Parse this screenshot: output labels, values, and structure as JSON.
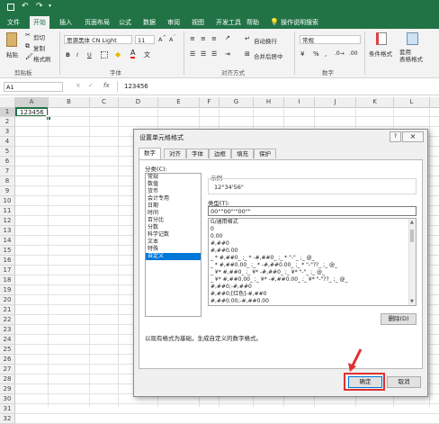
{
  "titlebar": {
    "save_icon": "save-icon",
    "undo_icon": "undo-icon",
    "redo_icon": "redo-icon"
  },
  "tabs": [
    "文件",
    "开始",
    "插入",
    "页面布局",
    "公式",
    "数据",
    "审阅",
    "视图",
    "开发工具",
    "帮助"
  ],
  "active_tab": "开始",
  "tell_me": "操作说明搜索",
  "ribbon": {
    "paste": "粘贴",
    "cut": "剪切",
    "copy": "复制",
    "format_painter": "格式刷",
    "clipboard": "剪贴板",
    "font_name": "思源黑体 CN Light",
    "font_size": "11",
    "font_group": "字体",
    "bold": "B",
    "italic": "I",
    "underline": "U",
    "wrap_text": "自动换行",
    "merge_center": "合并后居中",
    "align_group": "对齐方式",
    "number_format": "常规",
    "number_group": "数字",
    "conditional_format": "条件格式",
    "format_as_table": "套用\n表格格式"
  },
  "formula_bar": {
    "name_box": "A1",
    "fx": "fx",
    "value": "123456"
  },
  "columns": [
    "A",
    "B",
    "C",
    "D",
    "E",
    "F",
    "G",
    "H",
    "I",
    "J",
    "K",
    "L"
  ],
  "rows": [
    "1",
    "2",
    "3",
    "4",
    "5",
    "6",
    "7",
    "8",
    "9",
    "10",
    "11",
    "12",
    "13",
    "14",
    "15",
    "16",
    "17",
    "18",
    "19",
    "20",
    "21",
    "22",
    "23",
    "24",
    "25",
    "26",
    "27",
    "28",
    "29",
    "30",
    "31",
    "32"
  ],
  "cell_a1": "123456",
  "dialog": {
    "title": "设置单元格格式",
    "help": "?",
    "close": "×",
    "tabs": [
      "数字",
      "对齐",
      "字体",
      "边框",
      "填充",
      "保护"
    ],
    "category_label": "分类(C):",
    "categories": [
      "常规",
      "数值",
      "货币",
      "会计专用",
      "日期",
      "时间",
      "百分比",
      "分数",
      "科学记数",
      "文本",
      "特殊",
      "自定义"
    ],
    "selected_category": "自定义",
    "sample_label": "示例",
    "sample_value": "12°34'56\"",
    "type_label": "类型(T):",
    "type_value": "00°\"00\"'\"00\"\"",
    "formats": [
      "G/通用格式",
      "0",
      "0.00",
      "#,##0",
      "#,##0.00",
      "_ * #,##0_ ;_ * -#,##0_ ;_ * \"-\"_ ;_ @_",
      "_ * #,##0.00_ ;_ * -#,##0.00_ ;_ * \"-\"??_ ;_ @_",
      "_ ¥* #,##0_ ;_ ¥* -#,##0_ ;_ ¥* \"-\"_ ;_ @_",
      "_ ¥* #,##0.00_ ;_ ¥* -#,##0.00_ ;_ ¥* \"-\"??_ ;_ @_",
      "#,##0;-#,##0",
      "#,##0;[红色]-#,##0",
      "#,##0.00;-#,##0.00"
    ],
    "delete": "删除(D)",
    "description": "以现有格式为基础，生成自定义的数字格式。",
    "ok": "确定",
    "cancel": "取消"
  },
  "colors": {
    "excel_green": "#217346",
    "highlight_red": "#e03030",
    "selection_blue": "#0078d7"
  }
}
